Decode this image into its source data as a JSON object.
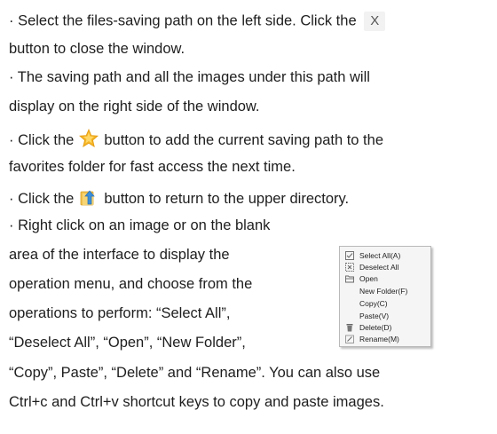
{
  "instructions": {
    "line1a": "· Select the files-saving path on the left side. Click the",
    "close_glyph": "X",
    "line2": "button to close the window.",
    "line3": "· The saving path and all the images under this path will",
    "line4": "display on the right side of the window.",
    "line5a": "· Click the",
    "line5b": "button to add the current saving path to the",
    "line6": "favorites folder for fast access the next time.",
    "line7a": "· Click the",
    "line7b": "button to return to the upper directory.",
    "line8": "· Right click on an image or on the blank",
    "line9": "area of the interface to display the",
    "line10": "operation menu, and choose from the",
    "line11": " operations to perform: “Select  All”,",
    "line12": "“Deselect All”, “Open”, “New Folder”,",
    "line13": "“Copy”, Paste”, “Delete” and “Rename”.  You can also use",
    "line14": "Ctrl+c and Ctrl+v shortcut keys to copy and paste images."
  },
  "menu": {
    "items": [
      {
        "label": "Select All(A)",
        "icon": "select-all-icon"
      },
      {
        "label": "Deselect All",
        "icon": "deselect-all-icon"
      },
      {
        "label": "Open",
        "icon": "open-folder-icon"
      },
      {
        "label": "New Folder(F)",
        "icon": ""
      },
      {
        "label": "Copy(C)",
        "icon": ""
      },
      {
        "label": "Paste(V)",
        "icon": ""
      },
      {
        "label": "Delete(D)",
        "icon": "trash-icon"
      },
      {
        "label": "Rename(M)",
        "icon": "rename-icon"
      }
    ]
  }
}
